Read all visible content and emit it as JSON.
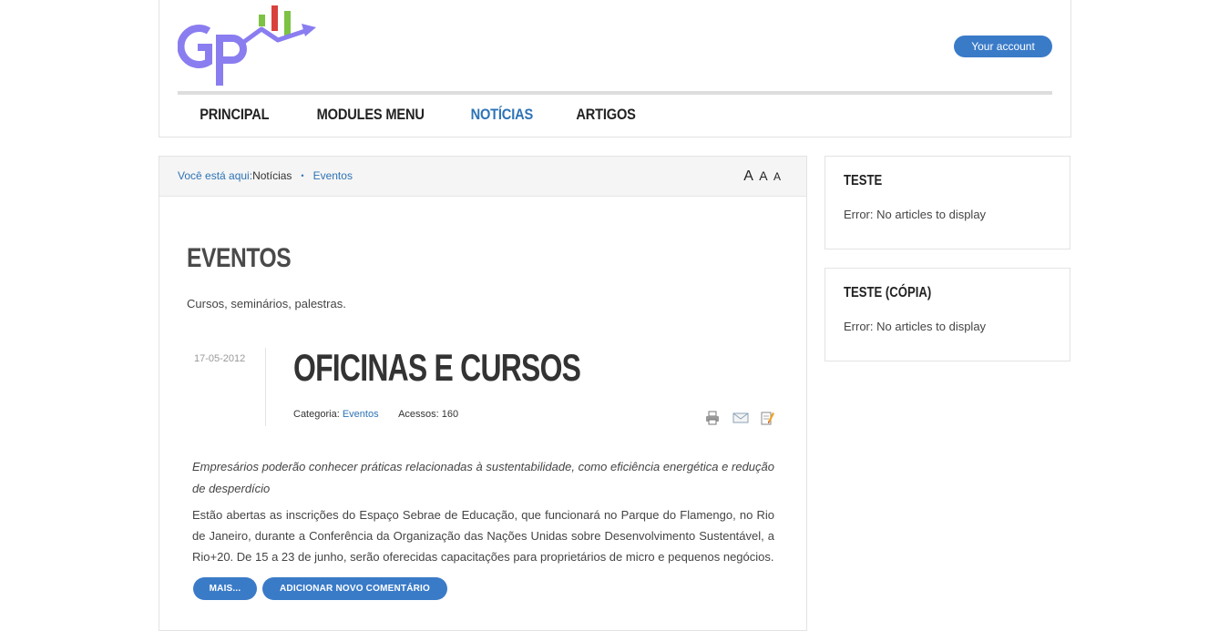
{
  "header": {
    "account_label": "Your account",
    "nav": [
      {
        "label": "PRINCIPAL"
      },
      {
        "label": "MODULES MENU"
      },
      {
        "label": "NOTÍCIAS"
      },
      {
        "label": "ARTIGOS"
      }
    ],
    "active_nav": "NOTÍCIAS",
    "logo_colors": {
      "letters": "#8a7df0",
      "arrow": "#8a7df0",
      "bars": [
        "#7dc243",
        "#d9413c",
        "#7dc243"
      ]
    }
  },
  "breadcrumb": {
    "label": "Você está aqui:",
    "current": "Notícias",
    "separator": "•",
    "link": "Eventos"
  },
  "font_size_controls": [
    "A",
    "A",
    "A"
  ],
  "category": {
    "title": "EVENTOS",
    "description": "Cursos, seminários, palestras."
  },
  "article": {
    "date": "17-05-2012",
    "title": "OFICINAS E CURSOS",
    "category_label": "Categoria:",
    "category_link": "Eventos",
    "hits_label": "Acessos: 160",
    "icons": [
      "print-icon",
      "email-icon",
      "edit-icon"
    ],
    "intro": "Empresários poderão conhecer práticas relacionadas à sustentabilidade, como eficiência energética e redução de desperdício",
    "body": "Estão abertas as inscrições do Espaço Sebrae de Educação, que funcionará no Parque do Flamengo, no Rio de Janeiro, durante a Conferência da Organização das Nações Unidas sobre Desenvolvimento Sustentável, a Rio+20. De 15 a 23 de junho, serão oferecidas capacitações para proprietários de micro e pequenos negócios.",
    "more_label": "MAIS...",
    "comment_label": "ADICIONAR NOVO COMENTÁRIO"
  },
  "sidebar": {
    "modules": [
      {
        "title": "TESTE",
        "text": "Error: No articles to display"
      },
      {
        "title": "TESTE (CÓPIA)",
        "text": "Error: No articles to display"
      }
    ]
  },
  "colors": {
    "accent": "#3a7bc8",
    "link": "#2d73b6"
  }
}
